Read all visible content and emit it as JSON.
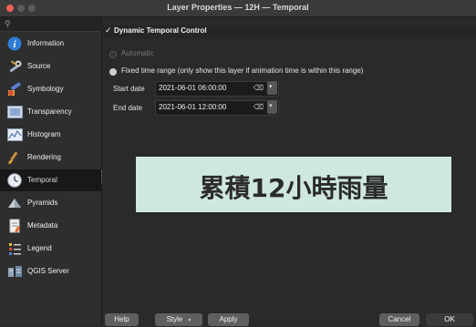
{
  "window": {
    "title": "Layer Properties — 12H — Temporal"
  },
  "sidebar": {
    "search_placeholder": "",
    "items": [
      {
        "label": "Information",
        "icon": "information-icon"
      },
      {
        "label": "Source",
        "icon": "source-wrench-icon"
      },
      {
        "label": "Symbology",
        "icon": "symbology-paintbrush-icon"
      },
      {
        "label": "Transparency",
        "icon": "transparency-icon"
      },
      {
        "label": "Histogram",
        "icon": "histogram-icon"
      },
      {
        "label": "Rendering",
        "icon": "rendering-brush-icon"
      },
      {
        "label": "Temporal",
        "icon": "temporal-clock-icon",
        "selected": true
      },
      {
        "label": "Pyramids",
        "icon": "pyramids-icon"
      },
      {
        "label": "Metadata",
        "icon": "metadata-icon"
      },
      {
        "label": "Legend",
        "icon": "legend-icon"
      },
      {
        "label": "QGIS Server",
        "icon": "qgis-server-icon"
      }
    ]
  },
  "temporal": {
    "checkbox_mark": "✓",
    "group_title": "Dynamic Temporal Control",
    "mode_automatic": "Automatic",
    "mode_fixed": "Fixed time range (only show this layer if animation time is within this range)",
    "start_label": "Start date",
    "start_value": "2021-06-01 06:00:00",
    "end_label": "End date",
    "end_value": "2021-06-01 12:00:00"
  },
  "banner": {
    "text": "累積12小時雨量",
    "background": "#cfe8df"
  },
  "buttons": {
    "help": "Help",
    "style": "Style",
    "apply": "Apply",
    "cancel": "Cancel",
    "ok": "OK"
  },
  "colors": {
    "close": "#ec5f56",
    "selected_nav": "#181818"
  }
}
